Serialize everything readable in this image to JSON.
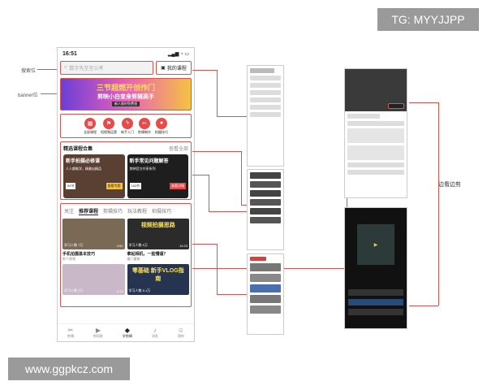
{
  "watermarks": {
    "top": "TG: MYYJJPP",
    "bottom": "www.ggpkcz.com"
  },
  "annotations": {
    "search": "搜索位",
    "banner": "banner位",
    "scroll": "边看边剪"
  },
  "phone": {
    "time": "16:51",
    "search_placeholder": "数字先至至公考",
    "my_course": "我的课程",
    "banner_line1": "三节超燃开创作门",
    "banner_line2": "剪映小白变身剪辑高手",
    "banner_sub": "新人限时免费领",
    "categories": [
      {
        "label": "全部课程",
        "icon": "grid-icon"
      },
      {
        "label": "短视频运营",
        "icon": "flag-icon"
      },
      {
        "label": "新手入门",
        "icon": "lightning-icon"
      },
      {
        "label": "剪辑制作",
        "icon": "scissors-icon"
      },
      {
        "label": "拍摄技巧",
        "icon": "camera-icon"
      }
    ],
    "featured": {
      "title": "精选课程合集",
      "more": "查看全部",
      "cards": [
        {
          "title": "新手拍摄必修课",
          "sub": "人人都能学，精美出精品",
          "meta": "54节",
          "btn": "查看专题"
        },
        {
          "title": "新手常见问题解答",
          "sub": "剪映官方共享系列",
          "meta": "163节",
          "btn": "查看详情"
        }
      ]
    },
    "tabs": [
      "关注",
      "推荐课程",
      "剪辑技巧",
      "玩法教程",
      "拍摄技巧"
    ],
    "videos": [
      {
        "thumb_text": "",
        "plays": "学习人数 7万",
        "duration": "4:52",
        "title": "手机拍摄基本技巧",
        "author": "剪个视频"
      },
      {
        "thumb_text": "视频拍摄思路",
        "plays": "学习人数 5万",
        "duration": "12:23",
        "title": "拿起相机，一脸懵逼？",
        "author": "摄门摄像"
      },
      {
        "thumb_text": "",
        "plays": "学习人数 3万",
        "duration": "2:13",
        "title": "",
        "author": ""
      },
      {
        "thumb_text": "零基础 新手VLOG指南",
        "plays": "学习人数 5.1万",
        "duration": "",
        "title": "",
        "author": ""
      }
    ],
    "nav": [
      {
        "label": "剪辑",
        "icon": "scissors-icon"
      },
      {
        "label": "剪同款",
        "icon": "play-square-icon"
      },
      {
        "label": "学剪辑",
        "icon": "graduation-cap-icon"
      },
      {
        "label": "消息",
        "icon": "bell-icon"
      },
      {
        "label": "我的",
        "icon": "user-icon"
      }
    ]
  }
}
